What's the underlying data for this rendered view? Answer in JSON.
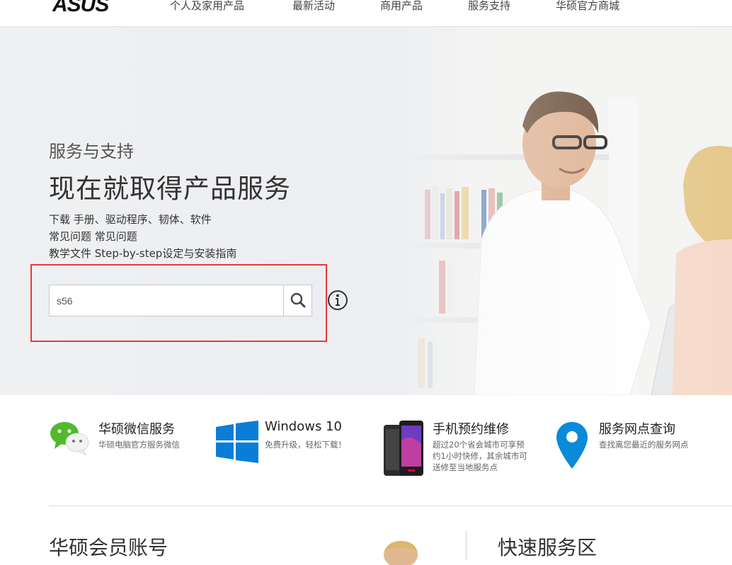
{
  "header": {
    "logo_text": "ASUS",
    "nav": [
      {
        "label": "个人及家用产品"
      },
      {
        "label": "最新活动"
      },
      {
        "label": "商用产品"
      },
      {
        "label": "服务支持"
      },
      {
        "label": "华硕官方商城"
      }
    ]
  },
  "hero": {
    "kicker": "服务与支持",
    "headline": "现在就取得产品服务",
    "lines": [
      "下载 手册、驱动程序、韧体、软件",
      "常见问题 常见问题",
      "教学文件 Step-by-step设定与安装指南"
    ],
    "search": {
      "value": "s56",
      "button_icon": "search-icon"
    },
    "info_icon": "info-icon",
    "highlight_color": "#e53a3a"
  },
  "services": [
    {
      "title": "华硕微信服务",
      "desc": [
        "华硕电脑官方服务微信"
      ],
      "icon": "wechat-icon"
    },
    {
      "title": "Windows 10",
      "desc": [
        "免费升级，轻松下载！"
      ],
      "icon": "windows-logo-icon"
    },
    {
      "title": "手机预约维修",
      "desc": [
        "超过20个省会城市可享预",
        "约1小时快修，其余城市可",
        "送修至当地服务点"
      ],
      "icon": "phone-icon"
    },
    {
      "title": "服务网点查询",
      "desc": [
        "查找离您最近的服务网点"
      ],
      "icon": "map-pin-icon"
    }
  ],
  "bottom": {
    "left_title": "华硕会员账号",
    "right_title": "快速服务区"
  },
  "colors": {
    "windows_blue": "#0a7dd6",
    "pin_blue": "#0b8ad8",
    "wechat_green": "#52b92d"
  }
}
